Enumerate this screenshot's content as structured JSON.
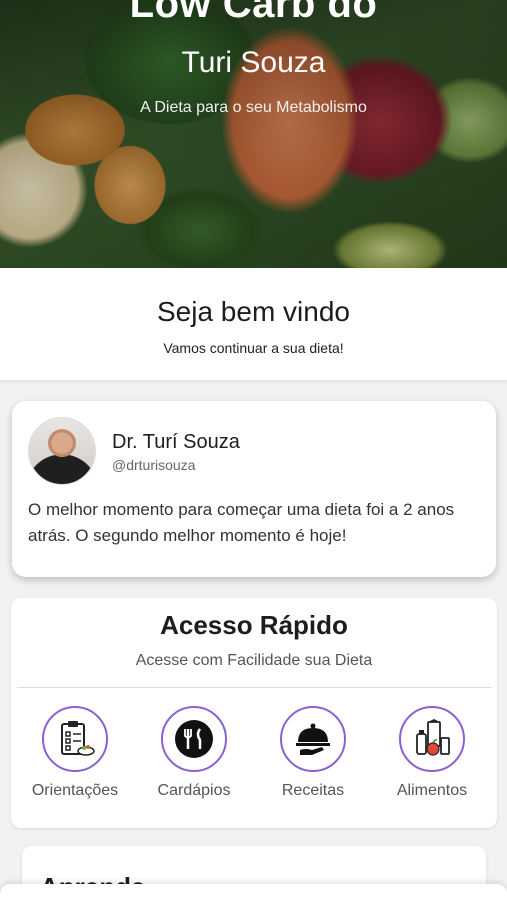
{
  "hero": {
    "title": "Low Carb do",
    "subtitle": "Turi Souza",
    "tagline": "A Dieta para o seu Metabolismo"
  },
  "welcome": {
    "title": "Seja bem vindo",
    "subtitle": "Vamos continuar a sua dieta!"
  },
  "quote_card": {
    "author_name": "Dr. Turí Souza",
    "author_handle": "@drturisouza",
    "quote": "O melhor momento para começar uma dieta foi a 2 anos atrás. O segundo melhor momento é hoje!"
  },
  "quick_access": {
    "title": "Acesso Rápido",
    "subtitle": "Acesse com Facilidade sua Dieta",
    "items": [
      {
        "label": "Orientações",
        "icon": "checklist-icon"
      },
      {
        "label": "Cardápios",
        "icon": "plate-cutlery-icon"
      },
      {
        "label": "Receitas",
        "icon": "cloche-icon"
      },
      {
        "label": "Alimentos",
        "icon": "groceries-icon"
      }
    ]
  },
  "learn": {
    "title": "Aprenda"
  },
  "colors": {
    "accent": "#8a63d2",
    "text_dark": "#1d1d1d"
  }
}
